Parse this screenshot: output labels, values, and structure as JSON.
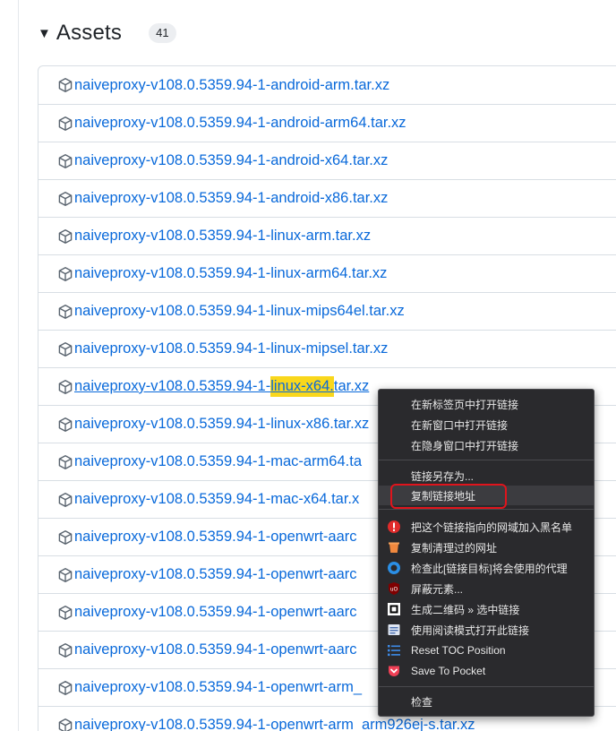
{
  "assets": {
    "title": "Assets",
    "count": "41",
    "items": [
      "naiveproxy-v108.0.5359.94-1-android-arm.tar.xz",
      "naiveproxy-v108.0.5359.94-1-android-arm64.tar.xz",
      "naiveproxy-v108.0.5359.94-1-android-x64.tar.xz",
      "naiveproxy-v108.0.5359.94-1-android-x86.tar.xz",
      "naiveproxy-v108.0.5359.94-1-linux-arm.tar.xz",
      "naiveproxy-v108.0.5359.94-1-linux-arm64.tar.xz",
      "naiveproxy-v108.0.5359.94-1-linux-mips64el.tar.xz",
      "naiveproxy-v108.0.5359.94-1-linux-mipsel.tar.xz",
      "naiveproxy-v108.0.5359.94-1-linux-x64.tar.xz",
      "naiveproxy-v108.0.5359.94-1-linux-x86.tar.xz",
      "naiveproxy-v108.0.5359.94-1-mac-arm64.ta",
      "naiveproxy-v108.0.5359.94-1-mac-x64.tar.x",
      "naiveproxy-v108.0.5359.94-1-openwrt-aarc",
      "naiveproxy-v108.0.5359.94-1-openwrt-aarc",
      "naiveproxy-v108.0.5359.94-1-openwrt-aarc",
      "naiveproxy-v108.0.5359.94-1-openwrt-aarc",
      "naiveproxy-v108.0.5359.94-1-openwrt-arm_",
      "naiveproxy-v108.0.5359.94-1-openwrt-arm_arm926ej-s.tar.xz"
    ],
    "selected_row": {
      "prefix": "naiveproxy-v108.0.5359.94-1-",
      "highlighted": "linux-x64.",
      "suffix": "tar.xz"
    }
  },
  "context_menu": {
    "open_new_tab": "在新标签页中打开链接",
    "open_new_window": "在新窗口中打开链接",
    "open_incognito": "在隐身窗口中打开链接",
    "save_link_as": "链接另存为...",
    "copy_link_address": "复制链接地址",
    "add_to_blacklist": "把这个链接指向的网域加入黑名单",
    "copy_cleaned_url": "复制清理过的网址",
    "check_proxy": "检查此[链接目标]将会使用的代理",
    "block_element": "屏蔽元素...",
    "generate_qr": "生成二维码 » 选中链接",
    "open_reader_mode": "使用阅读模式打开此链接",
    "reset_toc": "Reset TOC Position",
    "save_to_pocket": "Save To Pocket",
    "inspect": "检查"
  },
  "colors": {
    "link": "#0969da",
    "highlight": "#f9d71c",
    "menu_bg": "#2a2a2d",
    "focus_ring": "#e0141c"
  }
}
